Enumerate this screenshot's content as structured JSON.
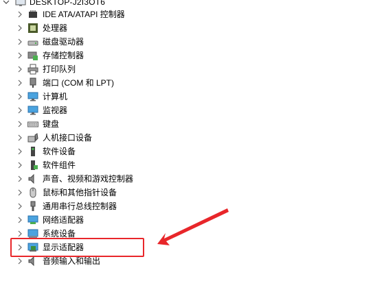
{
  "root": {
    "label": "DESKTOP-J2I3OT6",
    "icon": "computer-icon"
  },
  "categories": [
    {
      "label": "IDE ATA/ATAPI 控制器",
      "icon": "ide-controller-icon"
    },
    {
      "label": "处理器",
      "icon": "processor-icon"
    },
    {
      "label": "磁盘驱动器",
      "icon": "disk-drive-icon"
    },
    {
      "label": "存储控制器",
      "icon": "storage-controller-icon"
    },
    {
      "label": "打印队列",
      "icon": "printer-icon"
    },
    {
      "label": "端口 (COM 和 LPT)",
      "icon": "port-icon"
    },
    {
      "label": "计算机",
      "icon": "monitor-icon"
    },
    {
      "label": "监视器",
      "icon": "monitor-icon"
    },
    {
      "label": "键盘",
      "icon": "keyboard-icon"
    },
    {
      "label": "人机接口设备",
      "icon": "hid-icon"
    },
    {
      "label": "软件设备",
      "icon": "software-device-icon"
    },
    {
      "label": "软件组件",
      "icon": "software-component-icon"
    },
    {
      "label": "声音、视频和游戏控制器",
      "icon": "speaker-icon"
    },
    {
      "label": "鼠标和其他指针设备",
      "icon": "mouse-icon"
    },
    {
      "label": "通用串行总线控制器",
      "icon": "usb-icon"
    },
    {
      "label": "网络适配器",
      "icon": "network-adapter-icon"
    },
    {
      "label": "系统设备",
      "icon": "system-device-icon"
    },
    {
      "label": "显示适配器",
      "icon": "display-adapter-icon"
    },
    {
      "label": "音频输入和输出",
      "icon": "speaker-icon"
    }
  ],
  "highlight_color": "#e8262a",
  "text_color": "#000000"
}
